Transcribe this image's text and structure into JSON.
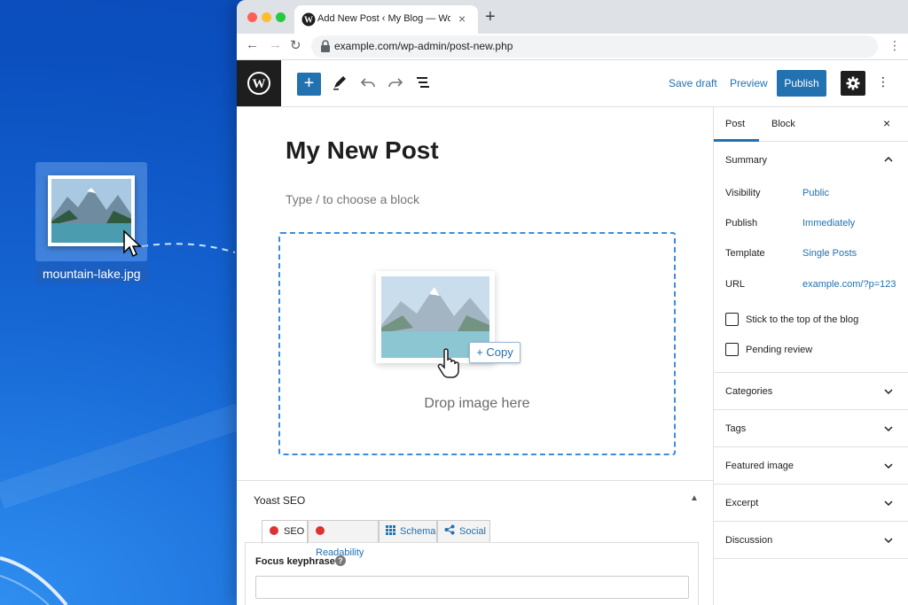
{
  "desktop": {
    "file_name": "mountain-lake.jpg"
  },
  "browser": {
    "tab_title": "Add New Post ‹ My Blog — WordPress",
    "tab_close": "×",
    "new_tab": "+",
    "url": "example.com/wp-admin/post-new.php"
  },
  "wp_header": {
    "add_label": "+",
    "save_draft": "Save draft",
    "preview": "Preview",
    "publish": "Publish"
  },
  "editor": {
    "post_title": "My New Post",
    "block_hint": "Type / to choose a block",
    "copy_label": "+ Copy",
    "drop_label": "Drop image here"
  },
  "yoast": {
    "title": "Yoast SEO",
    "tabs": [
      {
        "label": "SEO",
        "status_color": "#dc3232"
      },
      {
        "label": "Readability",
        "status_color": "#dc3232"
      },
      {
        "label": "Schema"
      },
      {
        "label": "Social"
      }
    ],
    "focus_keyphrase_label": "Focus keyphrase",
    "focus_keyphrase_value": "",
    "help": "?"
  },
  "sidebar": {
    "tabs": [
      "Post",
      "Block"
    ],
    "active_tab": "Post",
    "close": "×",
    "summary": {
      "title": "Summary",
      "rows": [
        {
          "label": "Visibility",
          "value": "Public"
        },
        {
          "label": "Publish",
          "value": "Immediately"
        },
        {
          "label": "Template",
          "value": "Single Posts"
        },
        {
          "label": "URL",
          "value": "example.com/?p=123"
        }
      ],
      "checkboxes": [
        {
          "label": "Stick to the top of the blog",
          "checked": false
        },
        {
          "label": "Pending review",
          "checked": false
        }
      ]
    },
    "panels": [
      "Categories",
      "Tags",
      "Featured image",
      "Excerpt",
      "Discussion"
    ]
  },
  "colors": {
    "wp_blue": "#2271b1",
    "desktop_blue": "#1565d2",
    "dropzone_border": "#3b8ce0"
  }
}
